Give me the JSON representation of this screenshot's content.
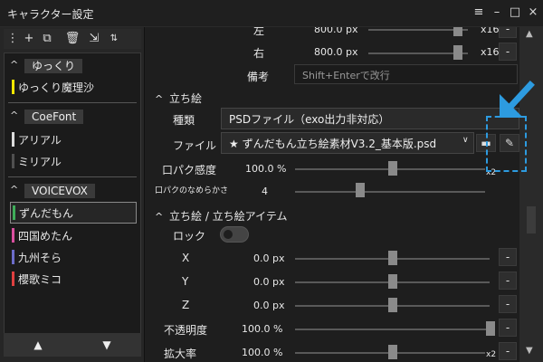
{
  "window": {
    "title": "キャラクター設定",
    "controls": [
      "≡",
      "–",
      "□",
      "×"
    ]
  },
  "left_panel": {
    "toolbar_icons": [
      "more-vert-icon",
      "add-icon",
      "copy-icon",
      "delete-icon",
      "import-icon",
      "sort-icon"
    ],
    "groups": [
      {
        "name": "ゆっくり",
        "items": [
          {
            "label": "ゆっくり魔理沙",
            "color": "#f2e600"
          }
        ]
      },
      {
        "name": "CoeFont",
        "items": [
          {
            "label": "アリアル",
            "color": "#dcdcdc"
          },
          {
            "label": "ミリアル",
            "color": "#505050"
          }
        ]
      },
      {
        "name": "VOICEVOX",
        "items": [
          {
            "label": "ずんだもん",
            "color": "#3fae5a",
            "selected": true
          },
          {
            "label": "四国めたん",
            "color": "#d94f9f"
          },
          {
            "label": "九州そら",
            "color": "#6c6cc9"
          },
          {
            "label": "櫻歌ミコ",
            "color": "#e04040"
          }
        ]
      }
    ],
    "footer": {
      "up": "▲",
      "down": "▼"
    }
  },
  "main": {
    "rows": {
      "left": {
        "label": "左",
        "value": "800.0 px",
        "multiplier": "x16"
      },
      "right": {
        "label": "右",
        "value": "800.0 px",
        "multiplier": "x16"
      },
      "memo": {
        "label": "備考",
        "placeholder": "Shift+Enterで改行"
      }
    },
    "tachie": {
      "title": "立ち絵",
      "kind_label": "種類",
      "kind_value": "PSDファイル（exo出力非対応）",
      "file_label": "ファイル",
      "file_value": "★ ずんだもん立ち絵素材V3.2_基本版.psd",
      "lipsync_label": "口パク感度",
      "lipsync_value": "100.0 %",
      "lipsync_mult": "x2",
      "lipsync_smooth_label": "口パクのなめらかさ",
      "lipsync_smooth_value": "4"
    },
    "tachie_item": {
      "title": "立ち絵 / 立ち絵アイテム",
      "lock_label": "ロック",
      "x_label": "X",
      "x_value": "0.0 px",
      "y_label": "Y",
      "y_value": "0.0 px",
      "z_label": "Z",
      "z_value": "0.0 px",
      "opacity_label": "不透明度",
      "opacity_value": "100.0 %",
      "scale_label": "拡大率",
      "scale_value": "100.0 %",
      "scale_mult": "x2"
    },
    "dash": "-"
  },
  "accent_color": "#2d9be0"
}
